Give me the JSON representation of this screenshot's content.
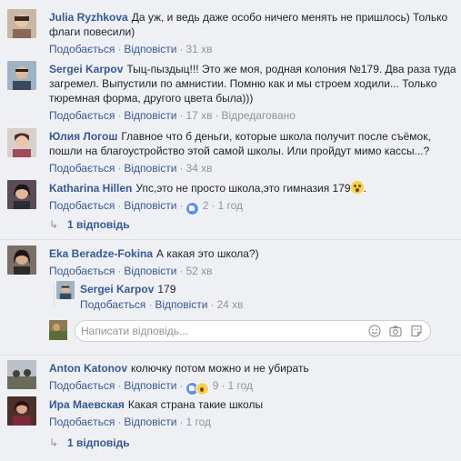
{
  "comments": [
    {
      "author": "Julia Ryzhkova",
      "text": "Да уж, и ведь даже особо ничего менять не пришлось) Только флаги повесили)",
      "like": "Подобається",
      "reply": "Відповісти",
      "time": "31 хв"
    },
    {
      "author": "Sergei Karpov",
      "text": "Тыц-пыздыц!!! Это же моя, родная колония №179. Два раза туда загремел. Выпустили по амнистии. Помню как и мы строем ходили... Только тюремная форма, другого цвета была)))",
      "like": "Подобається",
      "reply": "Відповісти",
      "time": "17 хв",
      "edited": "Відредаговано"
    },
    {
      "author": "Юлия Логош",
      "text": "Главное что б деньги, которые школа получит после съёмок, пошли на благоустройство этой самой школы. Или пройдут мимо кассы...?",
      "like": "Подобається",
      "reply": "Відповісти",
      "time": "34 хв"
    },
    {
      "author": "Katharina Hillen",
      "text": "Упс,это не просто школа,это гимназия 179",
      "like": "Подобається",
      "reply": "Відповісти",
      "reaction_count": "2",
      "time": "1 год",
      "replies": "1 відповідь"
    },
    {
      "author": "Eka Beradze-Fokina",
      "text": "А какая это школа?)",
      "like": "Подобається",
      "reply": "Відповісти",
      "time": "52 хв"
    },
    {
      "author": "Anton Katonov",
      "text": "колючку потом можно и не убирать",
      "like": "Подобається",
      "reply": "Відповісти",
      "reaction_count": "9",
      "time": "1 год"
    },
    {
      "author": "Ира Маевская",
      "text": "Какая страна такие школы",
      "like": "Подобається",
      "reply": "Відповісти",
      "time": "1 год",
      "replies": "1 відповідь"
    }
  ],
  "nested_reply": {
    "author": "Sergei Karpov",
    "text": "179",
    "like": "Подобається",
    "reply": "Відповісти",
    "time": "24 хв"
  },
  "reply_box": {
    "placeholder": "Написати відповідь..."
  },
  "icons": [
    "emoji-icon",
    "camera-icon",
    "sticker-icon",
    "reply-arrow-icon"
  ],
  "colors": {
    "link": "#365899",
    "meta": "#90949c",
    "background": "#eef0f4"
  }
}
